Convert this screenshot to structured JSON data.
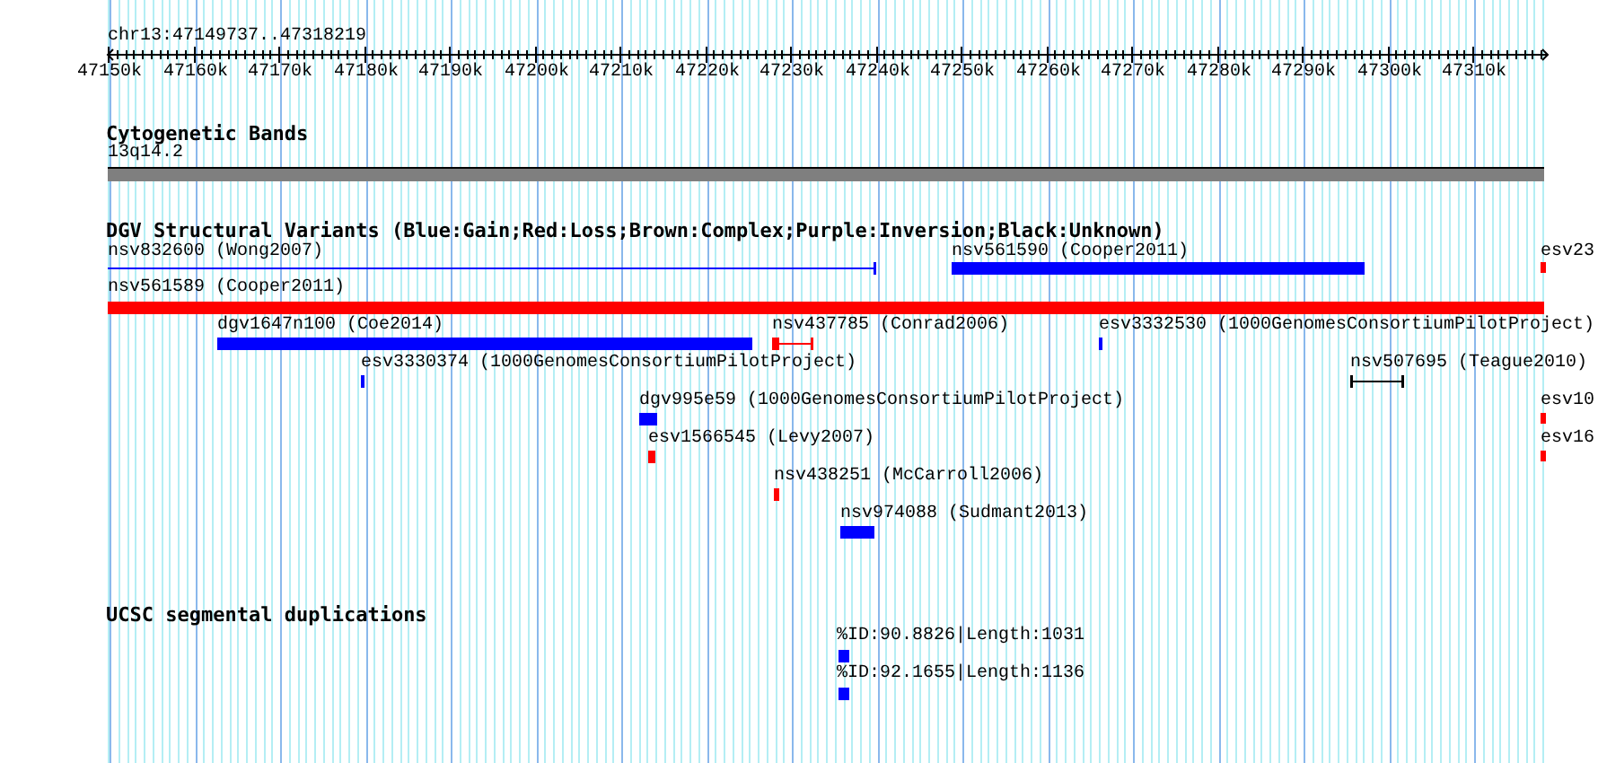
{
  "ruler": {
    "location": "chr13:47149737..47318219",
    "ticks": [
      "47150k",
      "47160k",
      "47170k",
      "47180k",
      "47190k",
      "47200k",
      "47210k",
      "47220k",
      "47230k",
      "47240k",
      "47250k",
      "47260k",
      "47270k",
      "47280k",
      "47290k",
      "47300k",
      "47310k"
    ]
  },
  "tracks": [
    {
      "title": "Cytogenetic Bands",
      "features": [
        {
          "label": "13q14.2",
          "kind": "band"
        }
      ]
    },
    {
      "title": "DGV Structural Variants (Blue:Gain;Red:Loss;Brown:Complex;Purple:Inversion;Black:Unknown)",
      "features": [
        {
          "label": "nsv832600 (Wong2007)",
          "kind": "span",
          "color": "#0000ff"
        },
        {
          "label": "nsv561590 (Cooper2011)",
          "kind": "bar",
          "color": "#0000ff"
        },
        {
          "label": "esv23",
          "kind": "bar",
          "color": "#ff0000"
        },
        {
          "label": "nsv561589 (Cooper2011)",
          "kind": "bar",
          "color": "#ff0000"
        },
        {
          "label": "dgv1647n100 (Coe2014)",
          "kind": "bar",
          "color": "#0000ff"
        },
        {
          "label": "nsv437785 (Conrad2006)",
          "kind": "span",
          "color": "#ff0000"
        },
        {
          "label": "esv3332530 (1000GenomesConsortiumPilotProject)",
          "kind": "bar",
          "color": "#0000ff"
        },
        {
          "label": "esv3330374 (1000GenomesConsortiumPilotProject)",
          "kind": "bar",
          "color": "#0000ff"
        },
        {
          "label": "nsv507695 (Teague2010)",
          "kind": "span",
          "color": "#000000"
        },
        {
          "label": "dgv995e59 (1000GenomesConsortiumPilotProject)",
          "kind": "bar",
          "color": "#0000ff"
        },
        {
          "label": "esv10",
          "kind": "bar",
          "color": "#ff0000"
        },
        {
          "label": "esv1566545 (Levy2007)",
          "kind": "bar",
          "color": "#ff0000"
        },
        {
          "label": "esv16",
          "kind": "bar",
          "color": "#ff0000"
        },
        {
          "label": "nsv438251 (McCarroll2006)",
          "kind": "bar",
          "color": "#ff0000"
        },
        {
          "label": "nsv974088 (Sudmant2013)",
          "kind": "bar",
          "color": "#0000ff"
        }
      ]
    },
    {
      "title": "UCSC segmental duplications",
      "features": [
        {
          "label": "%ID:90.8826|Length:1031",
          "kind": "bar",
          "color": "#0000ff"
        },
        {
          "label": "%ID:92.1655|Length:1136",
          "kind": "bar",
          "color": "#0000ff"
        }
      ]
    }
  ]
}
